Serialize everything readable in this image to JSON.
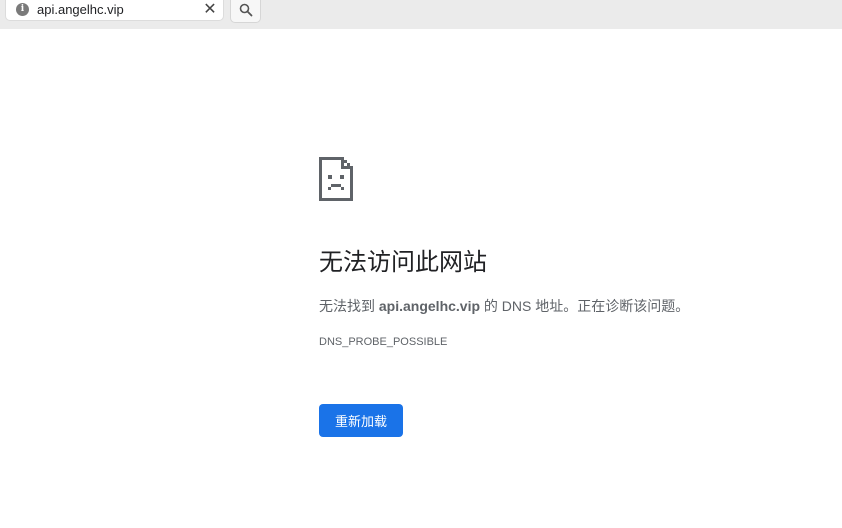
{
  "tab": {
    "info_icon_glyph": "i",
    "url": "api.angelhc.vip",
    "close_glyph": "✕"
  },
  "toolbar": {
    "search_icon": "search-icon"
  },
  "error": {
    "icon": "sad-document-icon",
    "title": "无法访问此网站",
    "desc_prefix": "无法找到 ",
    "desc_host": "api.angelhc.vip",
    "desc_suffix": " 的 DNS 地址。正在诊断该问题。",
    "code": "DNS_PROBE_POSSIBLE",
    "reload_label": "重新加载"
  },
  "colors": {
    "primary_button": "#1a73e8",
    "icon_gray": "#5f6368",
    "topbar": "#ebebeb"
  }
}
